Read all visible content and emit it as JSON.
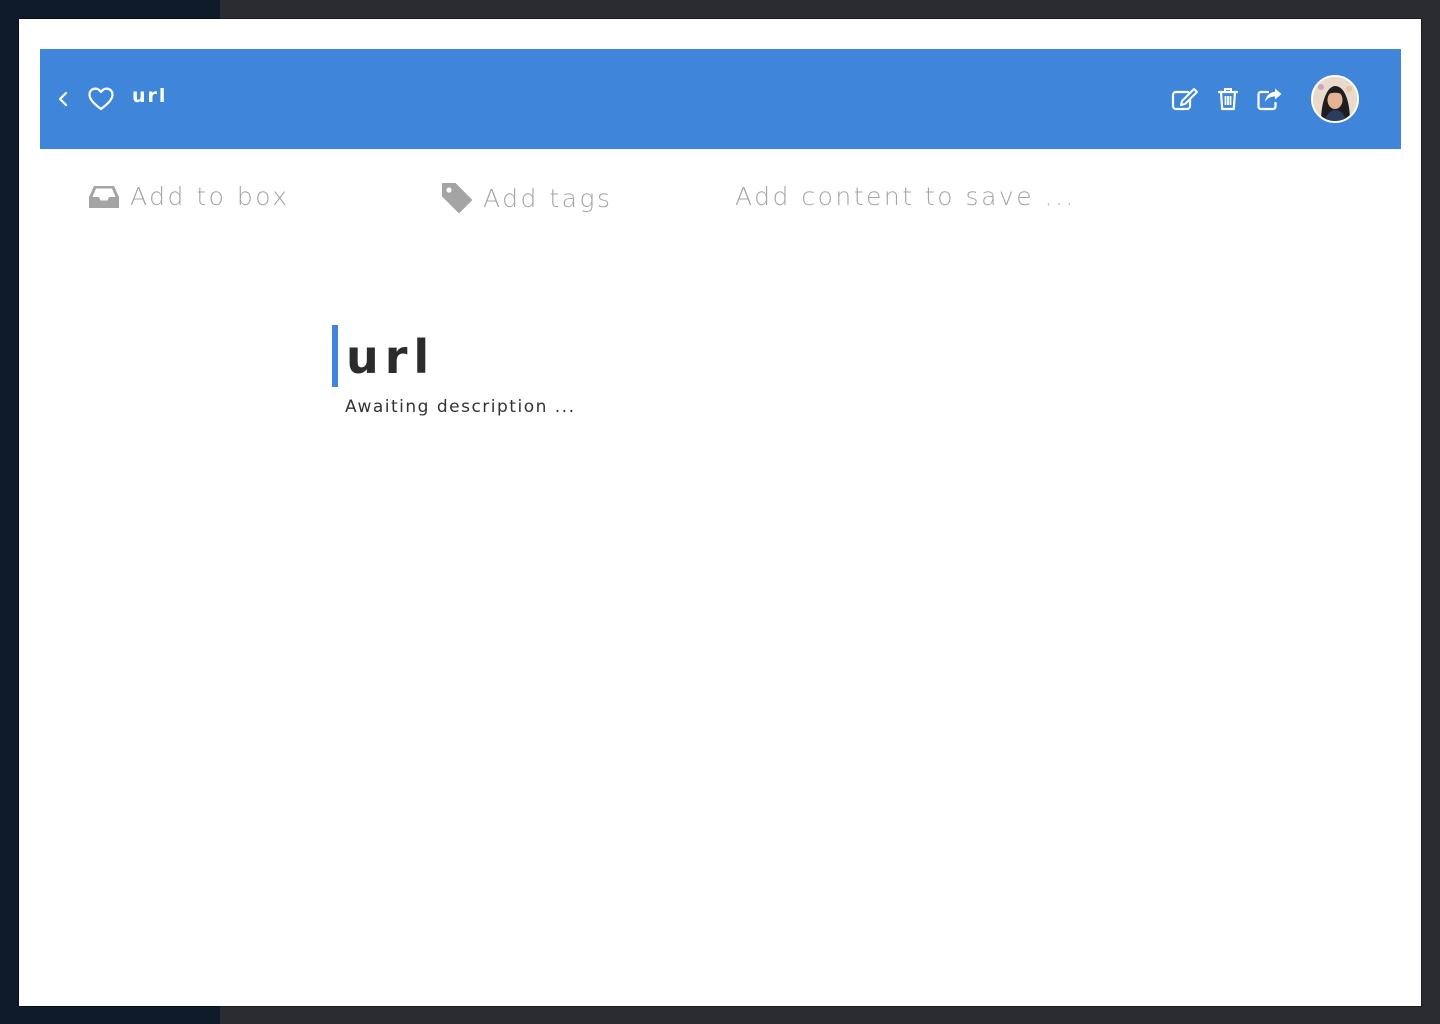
{
  "header": {
    "title": "url",
    "accent_color": "#3f86db"
  },
  "icons": {
    "back": "chevron-left-icon",
    "favorite": "heart-outline-icon",
    "edit": "edit-icon",
    "delete": "trash-icon",
    "share": "share-icon",
    "box": "inbox-icon",
    "tags": "tag-icon"
  },
  "toolbar": {
    "add_box_label": "Add to box",
    "add_tags_label": "Add tags",
    "add_content_placeholder": "Add content to save ..."
  },
  "note": {
    "title": "url",
    "description": "Awaiting description ..."
  }
}
